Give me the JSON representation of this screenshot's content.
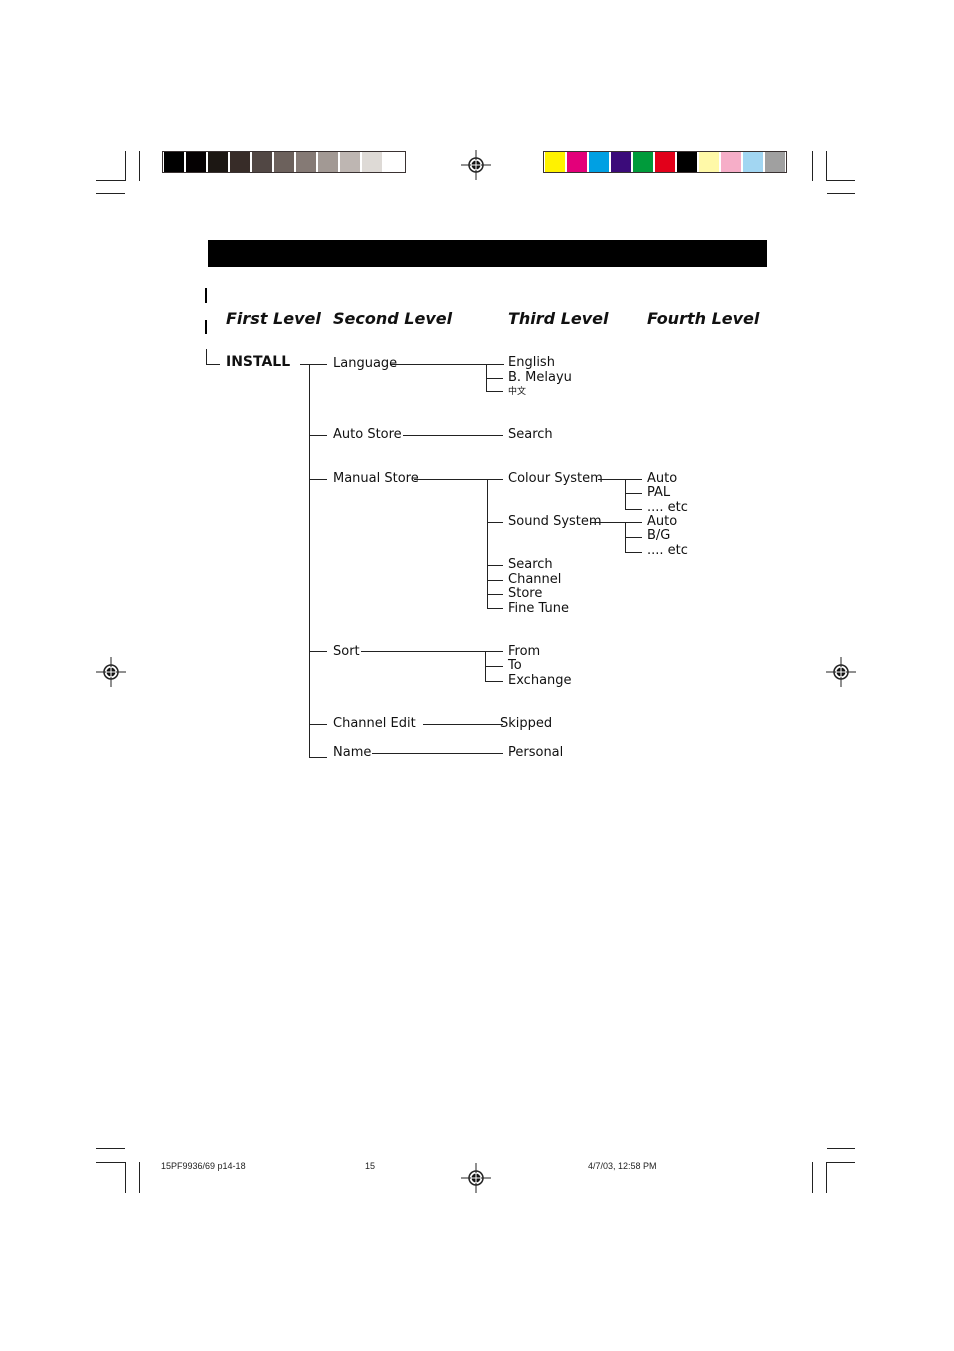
{
  "colorbar_left": [
    "#000000",
    "#050102",
    "#1c1713",
    "#372c28",
    "#514744",
    "#6c615c",
    "#857a75",
    "#a29994",
    "#beb6b2",
    "#dedad6",
    "#ffffff"
  ],
  "colorbar_right": [
    "#fff200",
    "#e3007a",
    "#00a0e3",
    "#3b0b7a",
    "#009b3b",
    "#e2001a",
    "#000000",
    "#fff9a8",
    "#f6aec8",
    "#a2d6f2",
    "#a0a0a0"
  ],
  "headings": {
    "first": "First Level",
    "second": "Second Level",
    "third": "Third Level",
    "fourth": "Fourth Level"
  },
  "tree": {
    "root": "INSTALL",
    "second_level": [
      "Language",
      "Auto Store",
      "Manual Store",
      "Sort",
      "Channel Edit",
      "Name"
    ],
    "language": [
      "English",
      "B. Melayu",
      "中文"
    ],
    "auto_store": [
      "Search"
    ],
    "manual_store": [
      "Colour System",
      "Sound System",
      "Search",
      "Channel",
      "Store",
      "Fine Tune"
    ],
    "colour_system": [
      "Auto",
      "PAL",
      ".... etc"
    ],
    "sound_system": [
      "Auto",
      "B/G",
      ".... etc"
    ],
    "sort": [
      "From",
      "To",
      "Exchange"
    ],
    "channel_edit": [
      "Skipped"
    ],
    "name": [
      "Personal"
    ]
  },
  "footer": {
    "doc_id": "15PF9936/69 p14-18",
    "page": "15",
    "timestamp": "4/7/03, 12:58 PM"
  }
}
